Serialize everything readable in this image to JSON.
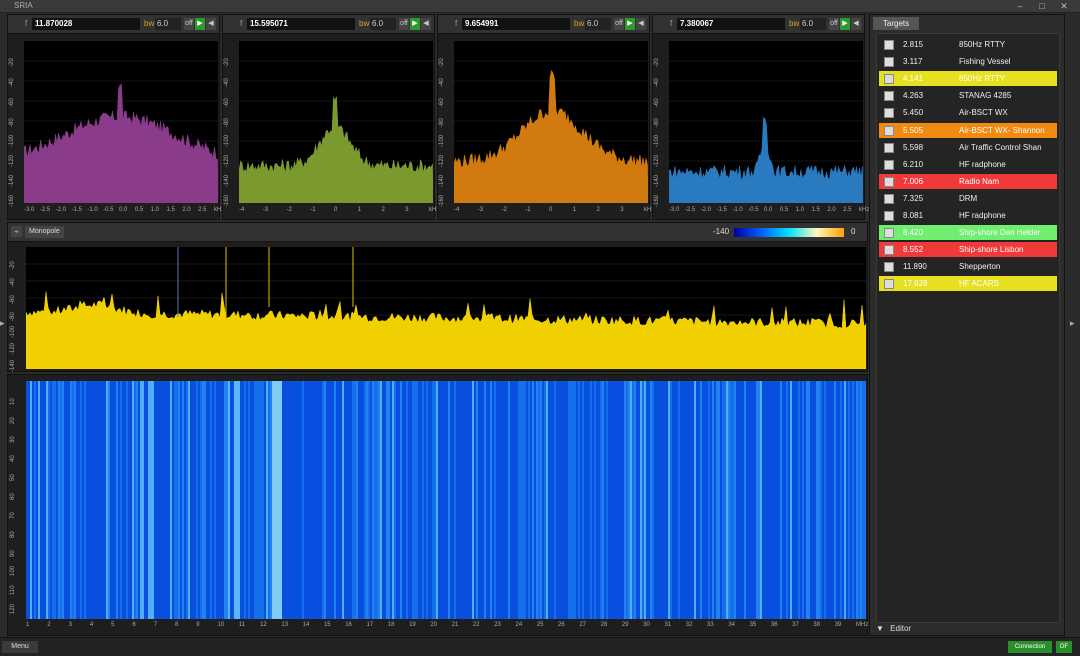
{
  "window": {
    "title": "SRIA",
    "minimize": "–",
    "maximize": "□",
    "close": "✕"
  },
  "small_panels": [
    {
      "frequency": "11.870028",
      "bw_label": "bw",
      "bw_value": "6.0",
      "color": "#8a3c8a",
      "yticks": [
        "-20",
        "-40",
        "-60",
        "-80",
        "-100",
        "-120",
        "-140",
        "-160"
      ],
      "xticks": [
        "-3.0",
        "-2.5",
        "-2.0",
        "-1.5",
        "-1.0",
        "-0.5",
        "0.0",
        "0.5",
        "1.0",
        "1.5",
        "2.0",
        "2.5",
        "kHz"
      ]
    },
    {
      "frequency": "15.595071",
      "bw_label": "bw",
      "bw_value": "6.0",
      "color": "#7a9a30",
      "yticks": [
        "-20",
        "-40",
        "-60",
        "-80",
        "-100",
        "-120",
        "-140",
        "-160"
      ],
      "xticks": [
        "-4",
        "-3",
        "-2",
        "-1",
        "0",
        "1",
        "2",
        "3",
        "kHz"
      ]
    },
    {
      "frequency": "9.654991",
      "bw_label": "bw",
      "bw_value": "6.0",
      "color": "#d07a10",
      "yticks": [
        "-20",
        "-40",
        "-60",
        "-80",
        "-100",
        "-120",
        "-140",
        "-160"
      ],
      "xticks": [
        "-4",
        "-3",
        "-2",
        "-1",
        "0",
        "1",
        "2",
        "3",
        "kHz"
      ]
    },
    {
      "frequency": "7.380067",
      "bw_label": "bw",
      "bw_value": "6.0",
      "color": "#2a7ac0",
      "yticks": [
        "-20",
        "-40",
        "-60",
        "-80",
        "-100",
        "-120",
        "-140",
        "-160"
      ],
      "xticks": [
        "-3.0",
        "-2.5",
        "-2.0",
        "-1.5",
        "-1.0",
        "-0.5",
        "0.0",
        "0.5",
        "1.0",
        "1.5",
        "2.0",
        "2.5",
        "kHz"
      ]
    }
  ],
  "toolbar_icons": {
    "freq_icon": "f",
    "btn_play": "▶",
    "btn_back": "◀",
    "btn_fwd": "▶",
    "btn_off": "off"
  },
  "main": {
    "monopole_label": "Monopole",
    "scale_min": "-140",
    "scale_max": "0",
    "spectrum_yticks": [
      "-20",
      "-40",
      "-60",
      "-80",
      "-100",
      "-120",
      "-140"
    ],
    "waterfall_yticks": [
      "10",
      "20",
      "30",
      "40",
      "50",
      "60",
      "70",
      "80",
      "90",
      "100",
      "110",
      "120"
    ],
    "xticks": [
      "1",
      "2",
      "3",
      "4",
      "5",
      "6",
      "7",
      "8",
      "9",
      "10",
      "11",
      "12",
      "13",
      "14",
      "15",
      "16",
      "17",
      "18",
      "19",
      "20",
      "21",
      "22",
      "23",
      "24",
      "25",
      "26",
      "27",
      "28",
      "29",
      "30",
      "31",
      "32",
      "33",
      "34",
      "35",
      "36",
      "37",
      "38",
      "39",
      "MHz"
    ]
  },
  "targets": {
    "tab_label": "Targets",
    "items": [
      {
        "value": "2.815",
        "name": "850Hz RTTY",
        "bg": ""
      },
      {
        "value": "3.117",
        "name": "Fishing Vessel",
        "bg": ""
      },
      {
        "value": "4.141",
        "name": "850Hz RTTY",
        "bg": "#e6e020"
      },
      {
        "value": "4.263",
        "name": "STANAG 4285",
        "bg": ""
      },
      {
        "value": "5.450",
        "name": "Air-BSCT WX",
        "bg": ""
      },
      {
        "value": "5.505",
        "name": "Air-BSCT WX- Shannon",
        "bg": "#f08a10"
      },
      {
        "value": "5.598",
        "name": "Air Traffic Control Shan",
        "bg": ""
      },
      {
        "value": "6.210",
        "name": "HF radphone",
        "bg": ""
      },
      {
        "value": "7.006",
        "name": "Radio Nam",
        "bg": "#f03a3a"
      },
      {
        "value": "7.325",
        "name": "DRM",
        "bg": ""
      },
      {
        "value": "8.081",
        "name": "HF radphone",
        "bg": ""
      },
      {
        "value": "8.420",
        "name": "Ship-shore Den Helder",
        "bg": "#70ee70"
      },
      {
        "value": "8.552",
        "name": "Ship-shore Lisbon",
        "bg": "#f03a3a"
      },
      {
        "value": "11.890",
        "name": "Shepperton",
        "bg": ""
      },
      {
        "value": "17.928",
        "name": "HF ACARS",
        "bg": "#e6e020"
      }
    ],
    "editor_label": "Editor"
  },
  "footer": {
    "menu_label": "Menu",
    "connection_label": "Connection",
    "df_label": "DF"
  }
}
